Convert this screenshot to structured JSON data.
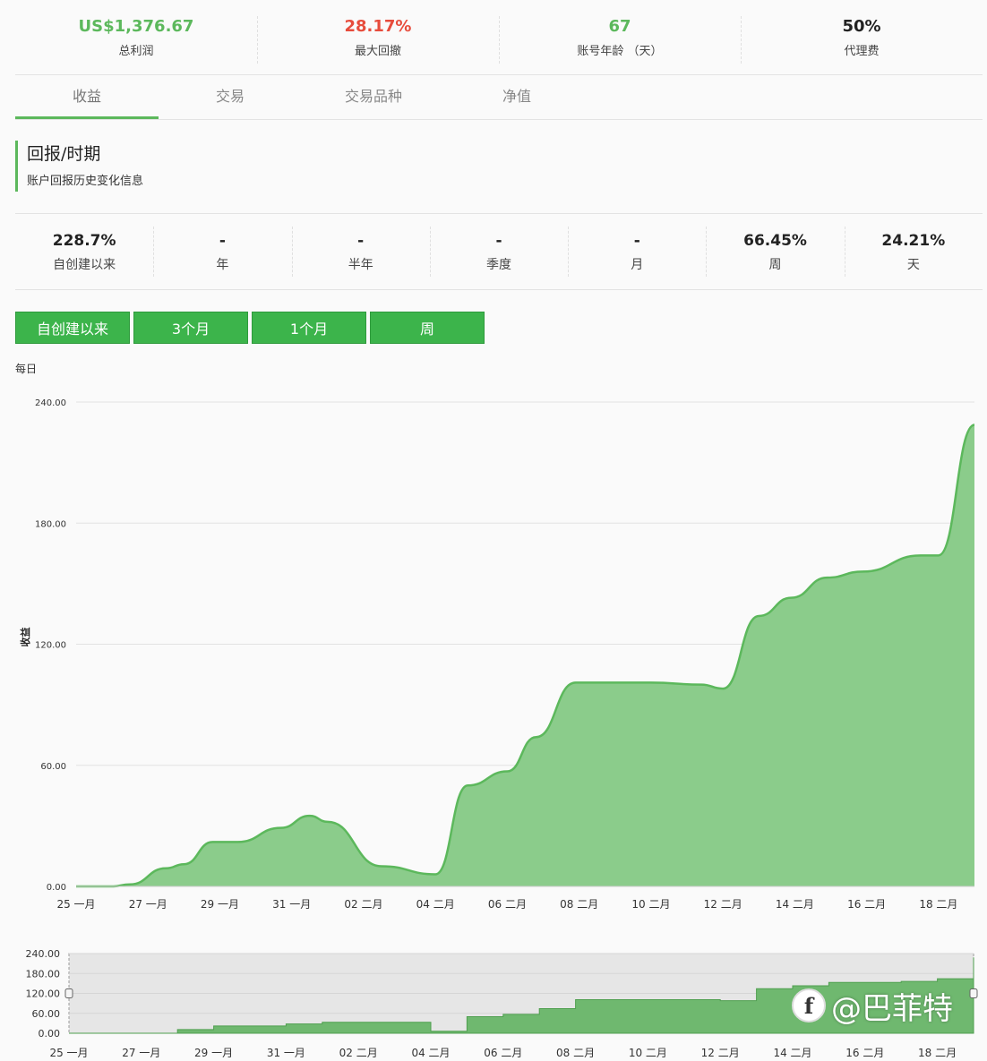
{
  "summary": [
    {
      "value": "US$1,376.67",
      "label": "总利润",
      "color": "green"
    },
    {
      "value": "28.17%",
      "label": "最大回撤",
      "color": "red"
    },
    {
      "value": "67",
      "label": "账号年龄 （天）",
      "color": "green"
    },
    {
      "value": "50%",
      "label": "代理费",
      "color": "dark"
    }
  ],
  "tabs": [
    {
      "label": "收益",
      "active": true
    },
    {
      "label": "交易",
      "active": false
    },
    {
      "label": "交易品种",
      "active": false
    },
    {
      "label": "净值",
      "active": false
    }
  ],
  "section": {
    "title": "回报/时期",
    "subtitle": "账户回报历史变化信息"
  },
  "periods": [
    {
      "value": "228.7%",
      "label": "自创建以来"
    },
    {
      "value": "-",
      "label": "年"
    },
    {
      "value": "-",
      "label": "半年"
    },
    {
      "value": "-",
      "label": "季度"
    },
    {
      "value": "-",
      "label": "月"
    },
    {
      "value": "66.45%",
      "label": "周"
    },
    {
      "value": "24.21%",
      "label": "天"
    }
  ],
  "range_buttons": [
    "自创建以来",
    "3个月",
    "1个月",
    "周"
  ],
  "frequency_label": "每日",
  "watermark": "@巴菲特",
  "colors": {
    "accent": "#5cb85c",
    "area_fill": "#8bcc8b",
    "area_line": "#5cb85c",
    "drawdown": "#e74c3c",
    "button": "#3cb44b"
  },
  "chart_data": {
    "type": "area",
    "title": "",
    "ylabel": "收益",
    "xlabel": "",
    "ylim": [
      0,
      240
    ],
    "yticks": [
      "0.00",
      "60.00",
      "120.00",
      "180.00",
      "240.00"
    ],
    "xticks": [
      "25 一月",
      "27 一月",
      "29 一月",
      "31 一月",
      "02 二月",
      "04 二月",
      "06 二月",
      "08 二月",
      "10 二月",
      "12 二月",
      "14 二月",
      "16 二月",
      "18 二月"
    ],
    "grid": true,
    "points": [
      {
        "day": 0,
        "value": 0
      },
      {
        "day": 1,
        "value": 0
      },
      {
        "day": 1.5,
        "value": 1
      },
      {
        "day": 2.5,
        "value": 9
      },
      {
        "day": 3,
        "value": 11
      },
      {
        "day": 3.8,
        "value": 22
      },
      {
        "day": 4.5,
        "value": 22
      },
      {
        "day": 5.7,
        "value": 29
      },
      {
        "day": 6.5,
        "value": 35
      },
      {
        "day": 7,
        "value": 32
      },
      {
        "day": 8.5,
        "value": 10
      },
      {
        "day": 10,
        "value": 6
      },
      {
        "day": 10.9,
        "value": 50
      },
      {
        "day": 12,
        "value": 57
      },
      {
        "day": 12.8,
        "value": 74
      },
      {
        "day": 13.9,
        "value": 101
      },
      {
        "day": 16,
        "value": 101
      },
      {
        "day": 17.4,
        "value": 100
      },
      {
        "day": 18,
        "value": 98
      },
      {
        "day": 19,
        "value": 134
      },
      {
        "day": 19.9,
        "value": 143
      },
      {
        "day": 20.9,
        "value": 153
      },
      {
        "day": 21.9,
        "value": 156
      },
      {
        "day": 23.5,
        "value": 164
      },
      {
        "day": 24,
        "value": 164
      },
      {
        "day": 25,
        "value": 228.7
      }
    ],
    "navigator": {
      "yticks": [
        "0.00",
        "60.00",
        "120.00",
        "180.00",
        "240.00"
      ],
      "steps": [
        {
          "day": 0,
          "value": 0
        },
        {
          "day": 3,
          "value": 11
        },
        {
          "day": 4,
          "value": 22
        },
        {
          "day": 6,
          "value": 28
        },
        {
          "day": 7,
          "value": 33
        },
        {
          "day": 10,
          "value": 6
        },
        {
          "day": 11,
          "value": 50
        },
        {
          "day": 12,
          "value": 57
        },
        {
          "day": 13,
          "value": 74
        },
        {
          "day": 14,
          "value": 101
        },
        {
          "day": 18,
          "value": 98
        },
        {
          "day": 19,
          "value": 134
        },
        {
          "day": 20,
          "value": 143
        },
        {
          "day": 21,
          "value": 153
        },
        {
          "day": 23,
          "value": 156
        },
        {
          "day": 24,
          "value": 164
        },
        {
          "day": 25,
          "value": 228.7
        }
      ]
    }
  }
}
